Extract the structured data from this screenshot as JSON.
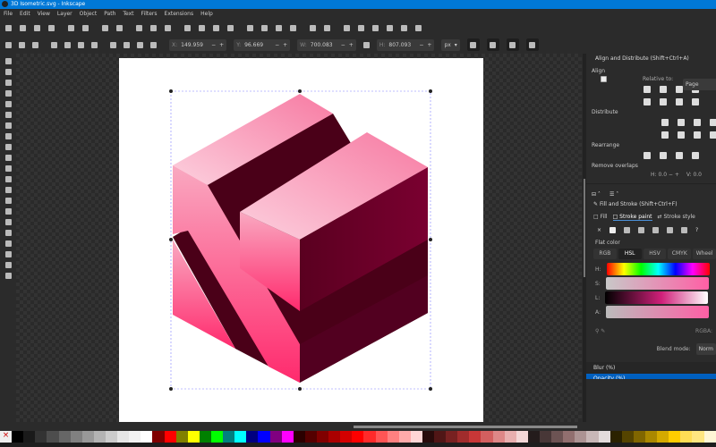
{
  "window": {
    "title": "3D Isometric.svg - Inkscape"
  },
  "menu": [
    "File",
    "Edit",
    "View",
    "Layer",
    "Object",
    "Path",
    "Text",
    "Filters",
    "Extensions",
    "Help"
  ],
  "toolbar_icons": [
    "new-doc",
    "open",
    "save",
    "print",
    "import",
    "export",
    "undo",
    "redo",
    "duplicate",
    "cut",
    "paste",
    "zoom-selection",
    "zoom-drawing",
    "zoom-page",
    "zoom-width",
    "group",
    "ungroup",
    "clone",
    "select-same",
    "transform",
    "xml-editor",
    "text-font",
    "layers",
    "object-props",
    "preferences",
    "document-props",
    "node-editor"
  ],
  "controls": {
    "x_label": "X:",
    "x": "149.959",
    "y_label": "Y:",
    "y": "96.669",
    "w_label": "W:",
    "w": "700.083",
    "h_label": "H:",
    "h": "807.093",
    "unit": "px",
    "minus": "−",
    "plus": "+"
  },
  "tools": [
    "selector",
    "node",
    "rectangle",
    "ellipse",
    "star",
    "3d-box",
    "spiral",
    "pencil",
    "pen",
    "calligraphy",
    "text",
    "gradient",
    "mesh",
    "dropper",
    "paint-bucket",
    "tweak",
    "spray",
    "eraser",
    "connector",
    "zoom",
    "measure"
  ],
  "panel": {
    "align": {
      "title": "Align and Distribute (Shift+Ctrl+A)",
      "align_label": "Align",
      "relative_label": "Relative to:",
      "relative_value": "Page",
      "distribute_label": "Distribute",
      "rearrange_label": "Rearrange",
      "overlap_label": "Remove overlaps",
      "h_label": "H:",
      "h_value": "0.0",
      "v_label": "V:",
      "v_value": "0.0"
    },
    "fill": {
      "title": "Fill and Stroke (Shift+Ctrl+F)",
      "tabs": [
        "Fill",
        "Stroke paint",
        "Stroke style"
      ],
      "active_tab": "Stroke paint",
      "flat_color": "Flat color",
      "modes": [
        "RGB",
        "HSL",
        "HSV",
        "CMYK",
        "Wheel"
      ],
      "active_mode": "HSL",
      "sliders": [
        "H:",
        "S:",
        "L:",
        "A:"
      ],
      "levels": {
        "H": 0.93,
        "S": 0.75,
        "L": 0.7,
        "A": 1.0
      },
      "rgba_label": "RGBA:",
      "blend_label": "Blend mode:",
      "blend_value": "Norm",
      "blur_label": "Blur (%)",
      "opacity_label": "Opacity (%)"
    }
  },
  "colors": {
    "accent": "#0078d7",
    "pink_light": "#fbc4d6",
    "pink": "#ff2a6d",
    "dark": "#4a0018"
  },
  "palette": [
    "#000000",
    "#1a1a1a",
    "#333333",
    "#4d4d4d",
    "#666666",
    "#808080",
    "#999999",
    "#b3b3b3",
    "#cccccc",
    "#e6e6e6",
    "#f2f2f2",
    "#ffffff",
    "#800000",
    "#ff0000",
    "#808000",
    "#ffff00",
    "#008000",
    "#00ff00",
    "#008080",
    "#00ffff",
    "#000080",
    "#0000ff",
    "#800080",
    "#ff00ff",
    "#2b0000",
    "#550000",
    "#800000",
    "#aa0000",
    "#d40000",
    "#ff0000",
    "#ff2a2a",
    "#ff5555",
    "#ff8080",
    "#ffaaaa",
    "#ffd5d5",
    "#280b0b",
    "#501616",
    "#782121",
    "#a02c2c",
    "#c83737",
    "#d35f5f",
    "#de8787",
    "#e9afaf",
    "#f4d7d7",
    "#241c1c",
    "#483737",
    "#6c5353",
    "#916f6f",
    "#ac9393",
    "#c8b7b7",
    "#e3dbdb",
    "#2b2200",
    "#554400",
    "#806600",
    "#aa8800",
    "#d4aa00",
    "#ffcc00",
    "#ffdd55",
    "#ffe680",
    "#fff6d5"
  ]
}
